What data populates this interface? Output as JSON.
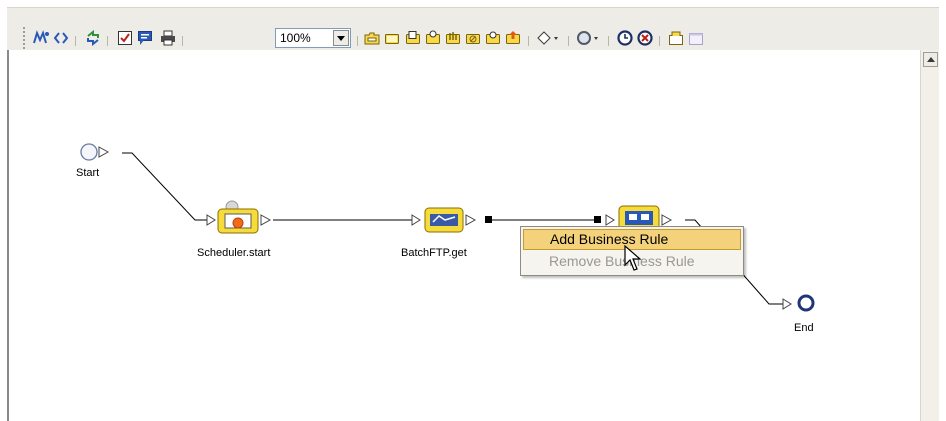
{
  "toolbar": {
    "zoom_value": "100%",
    "icons": [
      "map-icon",
      "code-icon",
      "refresh-icon",
      "validate-icon",
      "comment-icon",
      "print-icon",
      "folder-icon",
      "box-icon",
      "copy-icon",
      "paste-icon",
      "hand-icon",
      "deny-icon",
      "cycle-icon",
      "upload-icon",
      "decision-icon",
      "activity-icon",
      "clock-icon",
      "stop-icon",
      "export-icon",
      "window-icon"
    ]
  },
  "diagram": {
    "nodes": {
      "start": "Start",
      "scheduler": "Scheduler.start",
      "batchftp": "BatchFTP.get",
      "end": "End"
    }
  },
  "context_menu": {
    "items": [
      {
        "label": "Add Business Rule",
        "enabled": true,
        "highlighted": true
      },
      {
        "label": "Remove Business Rule",
        "enabled": false,
        "highlighted": false
      }
    ]
  },
  "colors": {
    "accent_top_border": "#7e9fd6",
    "menu_highlight": "#f4d27c",
    "node_blue": "#3a5aa8",
    "node_yellow": "#f5dc3a"
  }
}
